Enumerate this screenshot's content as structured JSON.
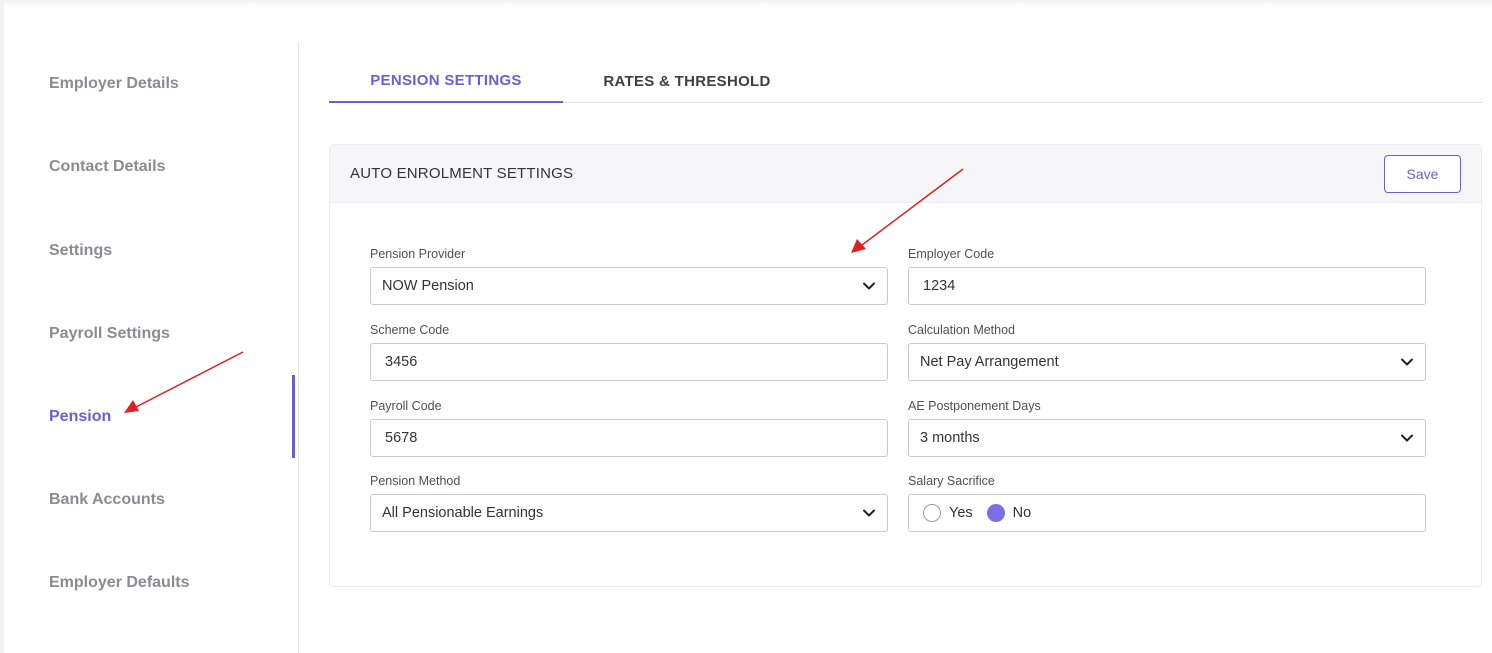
{
  "sidebar": {
    "items": [
      {
        "label": "Employer Details"
      },
      {
        "label": "Contact Details"
      },
      {
        "label": "Settings"
      },
      {
        "label": "Payroll Settings"
      },
      {
        "label": "Pension",
        "active": true
      },
      {
        "label": "Bank Accounts"
      },
      {
        "label": "Employer Defaults"
      }
    ]
  },
  "tabs": [
    {
      "label": "PENSION SETTINGS",
      "active": true
    },
    {
      "label": "RATES & THRESHOLD"
    }
  ],
  "card": {
    "title": "AUTO ENROLMENT SETTINGS",
    "save_label": "Save"
  },
  "form": {
    "pension_provider": {
      "label": "Pension Provider",
      "value": "NOW Pension"
    },
    "employer_code": {
      "label": "Employer Code",
      "value": "1234"
    },
    "scheme_code": {
      "label": "Scheme Code",
      "value": "3456"
    },
    "calculation_method": {
      "label": "Calculation Method",
      "value": "Net Pay Arrangement"
    },
    "payroll_code": {
      "label": "Payroll Code",
      "value": "5678"
    },
    "ae_postponement": {
      "label": "AE Postponement Days",
      "value": "3 months"
    },
    "pension_method": {
      "label": "Pension Method",
      "value": "All Pensionable Earnings"
    },
    "salary_sacrifice": {
      "label": "Salary Sacrifice",
      "yes": "Yes",
      "no": "No",
      "selected": "No"
    }
  },
  "colors": {
    "accent": "#6b5fd9",
    "annotation_arrow": "#e02020"
  }
}
